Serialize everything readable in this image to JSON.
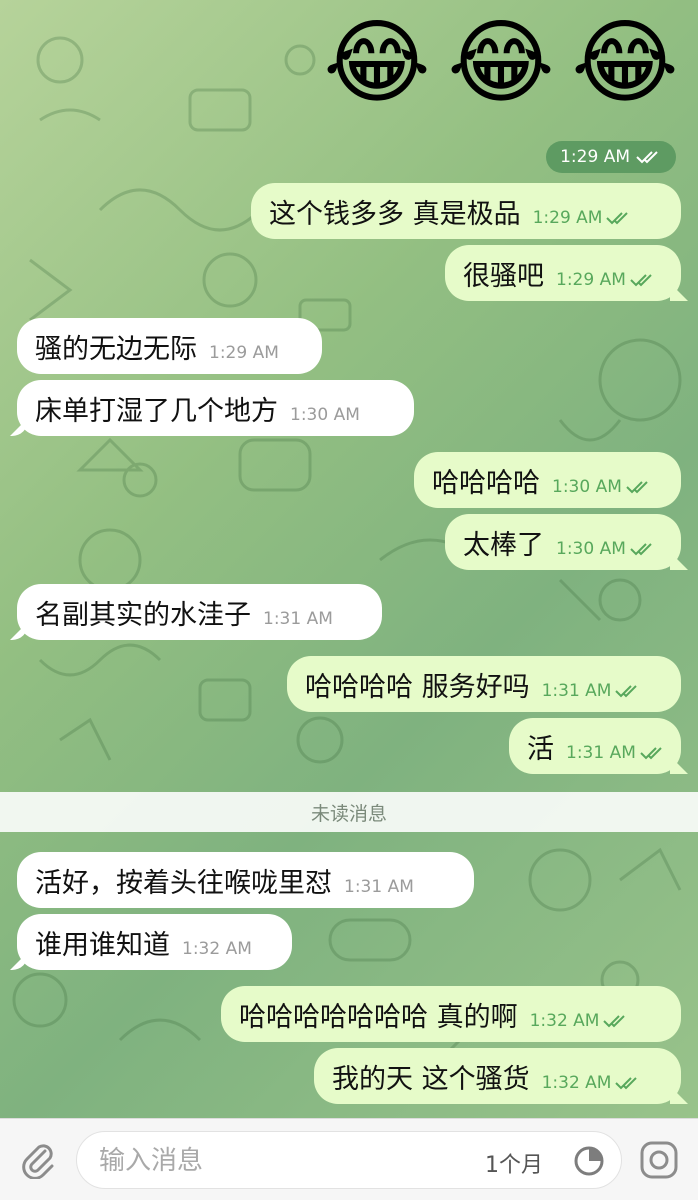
{
  "top": {
    "emojis": [
      "😂",
      "😂",
      "😂"
    ],
    "sticker_time": "1:29 AM"
  },
  "messages": [
    {
      "text": "这个钱多多 真是极品",
      "time": "1:29 AM"
    },
    {
      "text": "很骚吧",
      "time": "1:29 AM"
    },
    {
      "text": "骚的无边无际",
      "time": "1:29 AM"
    },
    {
      "text": "床单打湿了几个地方",
      "time": "1:30 AM"
    },
    {
      "text": "哈哈哈哈",
      "time": "1:30 AM"
    },
    {
      "text": "太棒了",
      "time": "1:30 AM"
    },
    {
      "text": "名副其实的水洼子",
      "time": "1:31 AM"
    },
    {
      "text": "哈哈哈哈 服务好吗",
      "time": "1:31 AM"
    },
    {
      "text": "活",
      "time": "1:31 AM"
    },
    {
      "text": "活好，按着头往喉咙里怼",
      "time": "1:31 AM"
    },
    {
      "text": "谁用谁知道",
      "time": "1:32 AM"
    },
    {
      "text": "哈哈哈哈哈哈哈 真的啊",
      "time": "1:32 AM"
    },
    {
      "text": "我的天 这个骚货",
      "time": "1:32 AM"
    }
  ],
  "unread_divider": "未读消息",
  "composer": {
    "placeholder": "输入消息",
    "timer_label": "1个月"
  },
  "colors": {
    "outgoing_bubble": "#e6fbc9",
    "incoming_bubble": "#ffffff",
    "read_check": "#58a85c"
  },
  "icons": [
    "attach-icon",
    "timer-icon",
    "camera-icon",
    "double-check-icon"
  ]
}
